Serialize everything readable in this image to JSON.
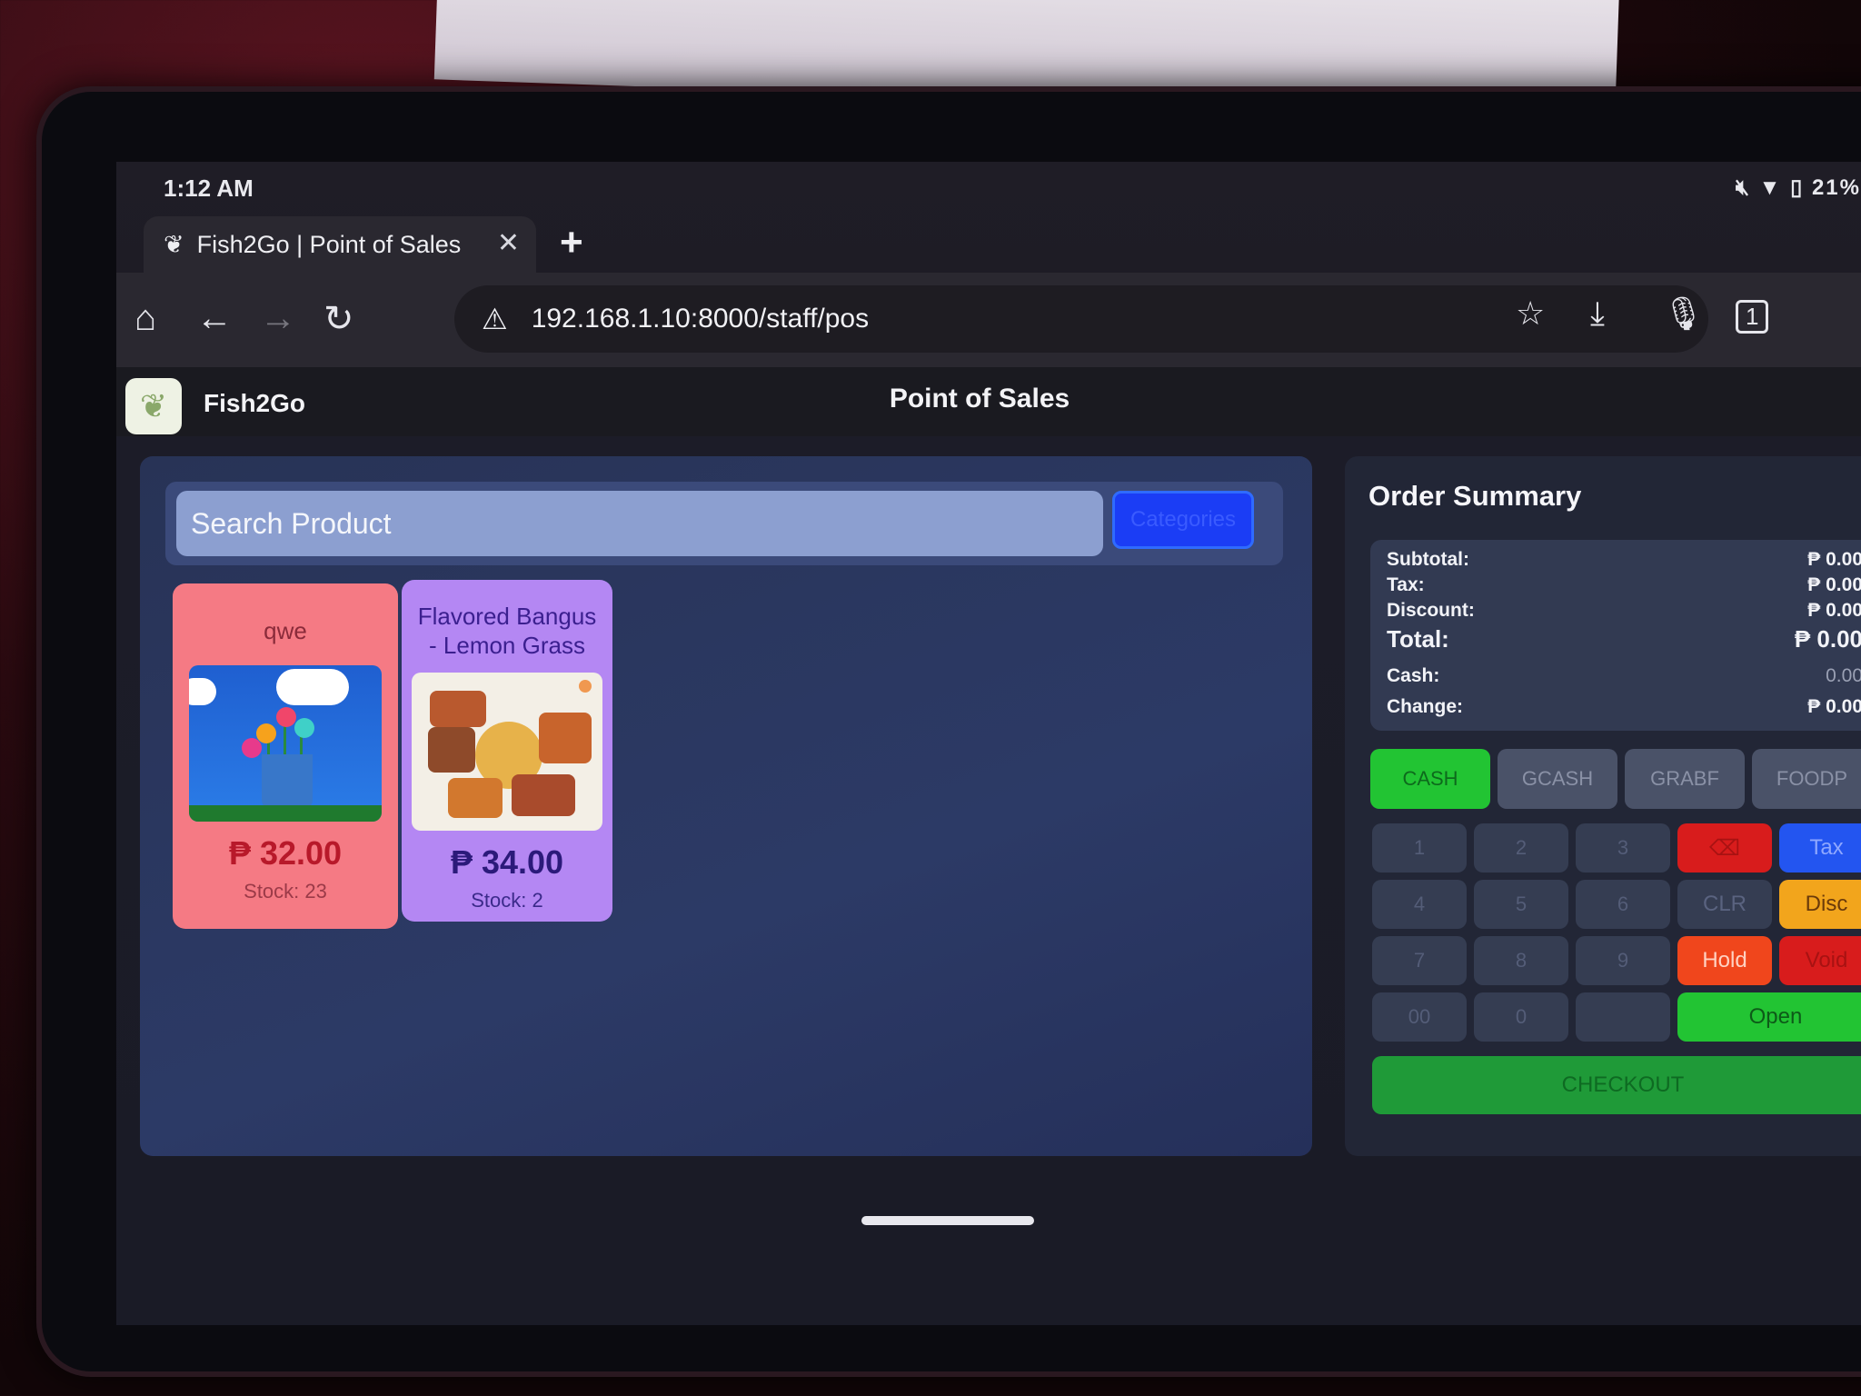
{
  "status": {
    "time": "1:12 AM",
    "battery": "21%"
  },
  "browser": {
    "tab_title": "Fish2Go | Point of Sales",
    "url": "192.168.1.10:8000/staff/pos",
    "tab_count": "1"
  },
  "app": {
    "brand": "Fish2Go",
    "page_title": "Point of Sales"
  },
  "search": {
    "placeholder": "Search Product",
    "categories_label": "Categories"
  },
  "products": [
    {
      "name": "qwe",
      "price": "₱ 32.00",
      "stock": "Stock: 23",
      "color": "#f57a84"
    },
    {
      "name": "Flavored Bangus - Lemon Grass",
      "price": "₱ 34.00",
      "stock": "Stock: 2",
      "color": "#b487f3"
    }
  ],
  "order_summary": {
    "title": "Order Summary",
    "subtotal_label": "Subtotal:",
    "subtotal": "₱ 0.00",
    "tax_label": "Tax:",
    "tax": "₱ 0.00",
    "discount_label": "Discount:",
    "discount": "₱ 0.00",
    "total_label": "Total:",
    "total": "₱ 0.00",
    "cash_label": "Cash:",
    "cash": "0.00",
    "change_label": "Change:",
    "change": "₱ 0.00"
  },
  "payment_methods": [
    "CASH",
    "GCASH",
    "GRABF",
    "FOODP"
  ],
  "keypad": [
    "1",
    "2",
    "3",
    "4",
    "5",
    "6",
    "7",
    "8",
    "9",
    "00",
    "0",
    ""
  ],
  "functions": {
    "backspace": "⌫",
    "tax": "Tax",
    "clr": "CLR",
    "disc": "Disc",
    "hold": "Hold",
    "void": "Void",
    "open": "Open",
    "checkout": "CHECKOUT"
  },
  "colors": {
    "cash_green": "#22c433",
    "tax_blue": "#2355f0",
    "disc_orange": "#f2a51c",
    "hold_orange": "#f0461c",
    "void_red": "#d81c1c",
    "checkout_green": "#1f9a38"
  }
}
